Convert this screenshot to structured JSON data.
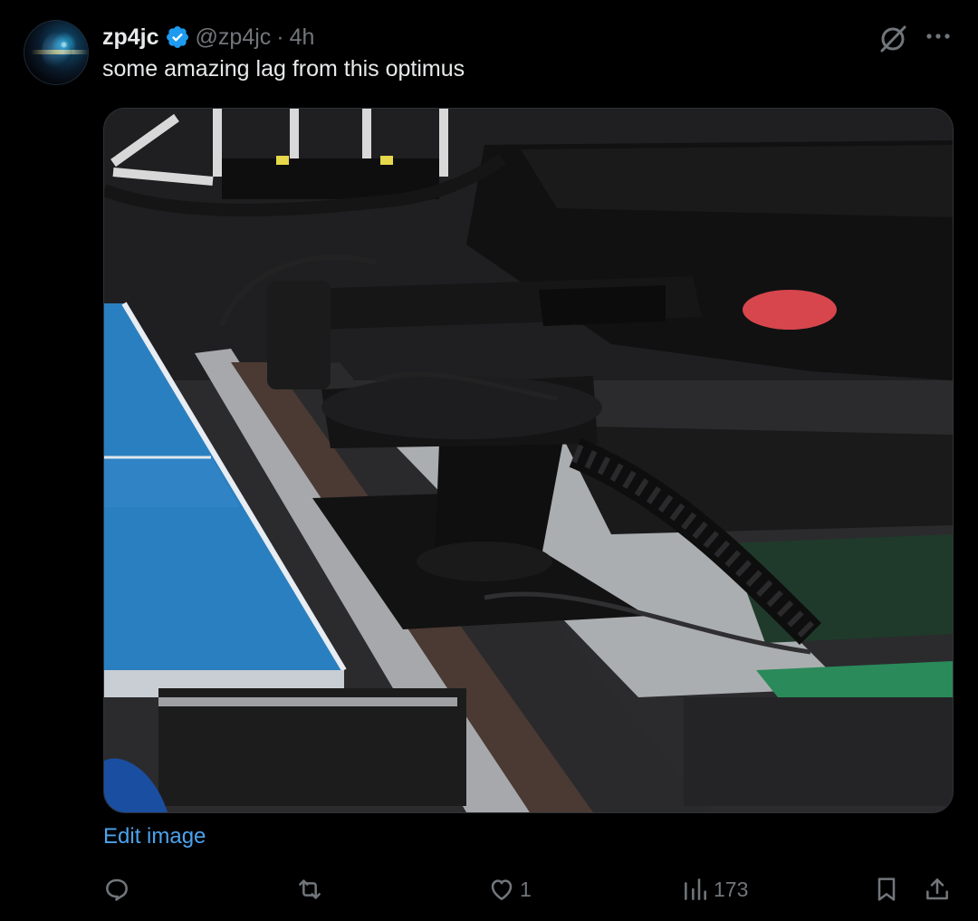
{
  "author": {
    "name": "zp4jc",
    "handle": "@zp4jc",
    "separator": "·",
    "time": "4h",
    "verified": true
  },
  "tweet": {
    "text": "some amazing lag from this optimus"
  },
  "media": {
    "edit_label": "Edit image"
  },
  "actions": {
    "reply_count": "",
    "repost_count": "",
    "like_count": "1",
    "views_count": "173"
  },
  "icons": {
    "verified": "verified-badge-icon",
    "grok": "grok-icon",
    "more": "more-icon",
    "reply": "reply-icon",
    "repost": "repost-icon",
    "like": "heart-icon",
    "views": "views-icon",
    "bookmark": "bookmark-icon",
    "share": "share-icon"
  },
  "colors": {
    "background": "#000000",
    "text": "#e7e9ea",
    "muted": "#71767b",
    "link": "#4ba3ee",
    "verified": "#1d9bf0"
  }
}
